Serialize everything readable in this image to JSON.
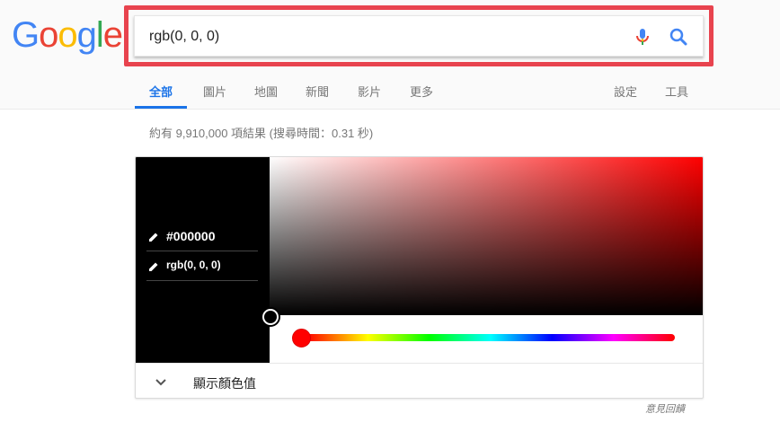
{
  "logo": {
    "letters": [
      "G",
      "o",
      "o",
      "g",
      "l",
      "e"
    ],
    "colors": [
      "#4285f4",
      "#ea4335",
      "#fbbc05",
      "#4285f4",
      "#34a853",
      "#ea4335"
    ]
  },
  "search": {
    "value": "rgb(0, 0, 0)",
    "mic_icon": "microphone-icon",
    "search_icon": "magnifier-icon",
    "highlight_color": "#e8434e"
  },
  "tabs": {
    "items": [
      "全部",
      "圖片",
      "地圖",
      "新聞",
      "影片",
      "更多"
    ],
    "active": "全部",
    "settings": "設定",
    "tools": "工具",
    "accent": "#1a73e8"
  },
  "results": {
    "stats": "約有 9,910,000 項結果 (搜尋時間：0.31 秒)"
  },
  "color_picker": {
    "hex": "#000000",
    "rgb": "rgb(0, 0, 0)",
    "swatch_color": "#000000",
    "hue_color": "#ff0000",
    "footer_label": "顯示顏色值"
  },
  "feedback": "意見回饋"
}
